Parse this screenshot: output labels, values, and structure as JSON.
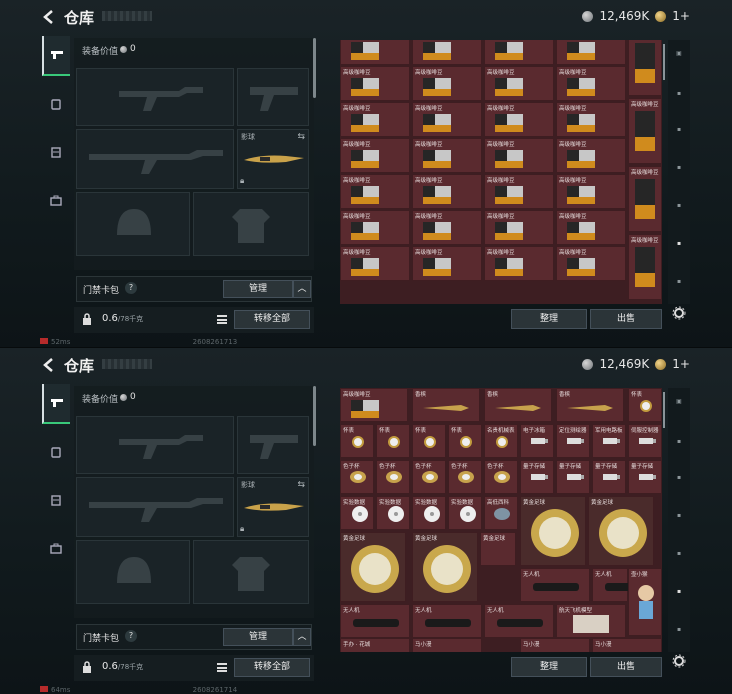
{
  "screens": [
    {
      "header": {
        "title": "仓库",
        "currency_silver": "12,469K",
        "currency_gold": "1+"
      },
      "loadout": {
        "equip_value_label": "装备价值",
        "equip_value": "0",
        "slot_label": "影球",
        "card_bar_label": "门禁卡包",
        "help": "?",
        "manage_label": "管理",
        "capacity_value": "0.6",
        "capacity_unit": "/78千克",
        "transfer_all_label": "转移全部"
      },
      "stash_items": [
        "高级咖啡豆",
        "高级咖啡豆",
        "高级咖啡豆",
        "高级咖啡豆",
        "高级咖啡豆",
        "高级咖啡豆",
        "高级咖啡豆",
        "高级咖啡豆",
        "高级咖啡豆",
        "高级咖啡豆",
        "高级咖啡豆",
        "高级咖啡豆",
        "高级咖啡豆",
        "高级咖啡豆",
        "高级咖啡豆",
        "高级咖啡豆",
        "高级咖啡豆",
        "高级咖啡豆",
        "高级咖啡豆",
        "高级咖啡豆",
        "高级咖啡豆",
        "高级咖啡豆",
        "高级咖啡豆",
        "高级咖啡豆",
        "高级咖啡豆",
        "高级咖啡豆",
        "高级咖啡豆",
        "高级咖啡豆",
        "高级咖啡豆",
        "高级咖啡豆",
        "高级咖啡豆",
        "高级咖啡豆",
        "高级咖啡豆",
        "高级咖啡豆",
        "高级咖啡豆",
        "高级咖啡豆",
        "高级咖啡豆",
        "高级咖啡豆",
        "高级咖啡豆",
        "高级咖啡豆"
      ],
      "actions": {
        "sort_label": "整理",
        "sell_label": "出售"
      },
      "footer": {
        "ping": "52ms",
        "uid": "2608261713"
      }
    },
    {
      "header": {
        "title": "仓库",
        "currency_silver": "12,469K",
        "currency_gold": "1+"
      },
      "loadout": {
        "equip_value_label": "装备价值",
        "equip_value": "0",
        "slot_label": "影球",
        "card_bar_label": "门禁卡包",
        "help": "?",
        "manage_label": "管理",
        "capacity_value": "0.6",
        "capacity_unit": "/78千克",
        "transfer_all_label": "转移全部"
      },
      "stash_items_row1": [
        "高级咖啡豆",
        "香槟",
        "香槟",
        "香槟",
        "怀表"
      ],
      "stash_items_row2": [
        "怀表",
        "怀表",
        "怀表",
        "怀表",
        "名贵机械表",
        "电子冰箱",
        "定位测绘器",
        "军用电路板",
        "伺服控制器"
      ],
      "stash_items_row3": [
        "色子杯",
        "色子杯",
        "色子杯",
        "色子杯",
        "色子杯",
        "量子存储",
        "量子存储",
        "量子存储",
        "量子存储"
      ],
      "stash_items_row4": [
        "实验数据",
        "实验数据",
        "实验数据",
        "实验数据",
        "高低西科",
        "黄金足球",
        "黄金足球"
      ],
      "stash_items_row5": [
        "黄金足球",
        "黄金足球",
        "黄金足球",
        "无人机",
        "无人机",
        "壶小猴"
      ],
      "stash_items_row6": [
        "无人机",
        "无人机",
        "无人机",
        "航天飞机模型"
      ],
      "stash_items_row7": [
        "手办 · 花城",
        "马小漫",
        "马小漫",
        "马小漫"
      ],
      "actions": {
        "sort_label": "整理",
        "sell_label": "出售"
      },
      "footer": {
        "ping": "64ms",
        "uid": "2608261714"
      }
    }
  ]
}
